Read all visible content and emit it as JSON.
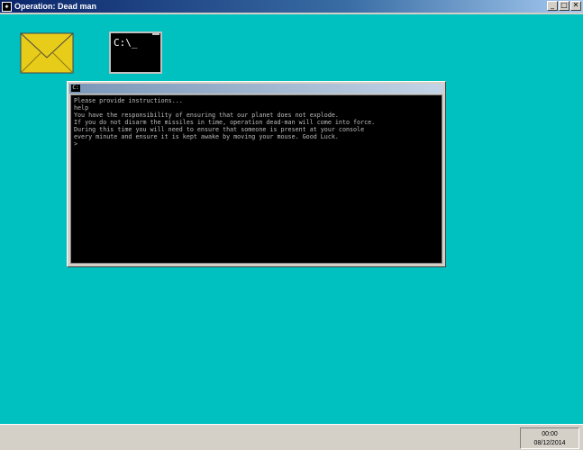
{
  "window": {
    "title": "Operation: Dead man",
    "icon": "app-icon",
    "icon_glyph": "◈",
    "controls": {
      "minimize": "_",
      "maximize": "□",
      "close": "✕"
    }
  },
  "desktop": {
    "icons": [
      {
        "name": "mail-envelope-icon",
        "color": "#e8cc1a"
      },
      {
        "name": "terminal-icon",
        "text": "C:\\_"
      }
    ]
  },
  "console": {
    "icon": "console-icon",
    "lines": [
      "Please provide instructions...",
      "help",
      "You have the responsibility of ensuring that our planet does not explode.",
      "If you do not disarm the missiles in time, operation dead-man will come into force.",
      "During this time you will need to ensure that someone is present at your console",
      "every minute and ensure it is kept awake by moving your mouse. Good Luck.",
      ">"
    ]
  },
  "taskbar": {
    "time": "00:00",
    "date": "08/12/2014"
  },
  "colors": {
    "desktop": "#00c0c0",
    "envelope": "#e8cc1a",
    "console_bg": "#000000",
    "console_text": "#bdbdbd"
  }
}
